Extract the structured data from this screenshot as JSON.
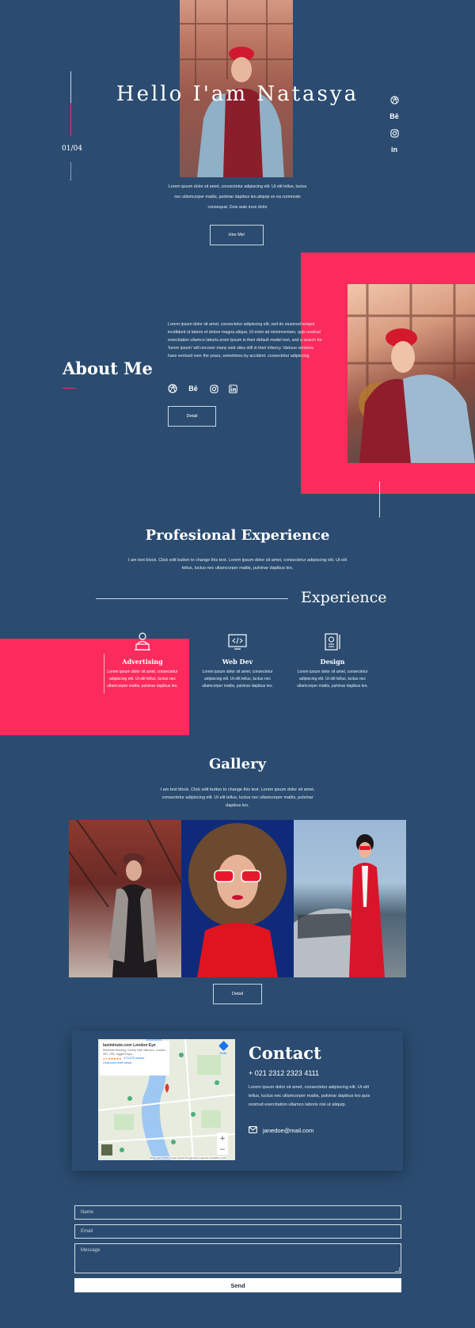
{
  "hero": {
    "title": "Hello I'am Natasya",
    "counter": "01/04",
    "text": "Lorem ipsum dolor sit amet, consectetur adipiscing elit. Ut elit tellus, luctus nec ullamcorper mattis, pulvinar dapibus leo.aliquip ex ea commodo consequat. Duis aute irure dolor",
    "button": "Hire Me!"
  },
  "social": {
    "dribbble": "dribbble-icon",
    "behance": "Bē",
    "instagram": "instagram-icon",
    "linkedin": "in"
  },
  "about": {
    "title": "About Me",
    "text": "Lorem ipsum dolor sit amet, consectetur adipiscing elit, sed do eiusmod tempor incididunt ut labore et dolore magna aliqua. Ut enim ad minimveniam, quis nostrud exercitation ullamco laboris.orem Ipsum is their default model text, and a search for 'lorem ipsum' will uncover many web sites still in their infancy. Various versions have evolved over the years, sometimes by accident. consectetur adipiscing",
    "button": "Detail"
  },
  "experience": {
    "title": "Profesional Experience",
    "text": "I am text block. Click edit button to change this text. Lorem ipsum dolor sit amet, consectetur adipiscing elit. Ut elit tellus, luctus nec ullamcorper mattis, pulvinar dapibus leo.",
    "label": "Experience",
    "items": [
      {
        "title": "Advertising",
        "text": "Lorem ipsum dolor sit amet, consectetur adipiscing elit. Ut elit tellus, luctus nec ullamcorper mattis, pulvinar dapibus leo."
      },
      {
        "title": "Web Dev",
        "text": "Lorem ipsum dolor sit amet, consectetur adipiscing elit. Ut elit tellus, luctus nec ullamcorper mattis, pulvinar dapibus leo."
      },
      {
        "title": "Design",
        "text": "Lorem ipsum dolor sit amet, consectetur adipiscing elit. Ut elit tellus, luctus nec ullamcorper mattis, pulvinar dapibus leo."
      }
    ]
  },
  "gallery": {
    "title": "Gallery",
    "text": "I am text block. Click edit button to change this text. Lorem ipsum dolor sit amet, consectetur adipiscing elit. Ut elit tellus, luctus nec ullamcorper mattis, pulvinar dapibus leo.",
    "button": "Detail"
  },
  "contact": {
    "title": "Contact",
    "phone": "+ 021 2312 2323 4111",
    "text": "Lorem ipsum dolor sit amet, consectetur adipiscing elit. Ut elit tellus, luctus nec ullamcorper mattis, pulvinar dapibus leo.quis nostrud exercitation ullamco laboris nisi ut aliquip.",
    "email": "janedoe@mail.com",
    "map": {
      "place": "lastminute.com London Eye",
      "address": "Riverside Building, County Hall, Bishop's, London SE1 7PB, Inggris Raya",
      "rating": "4,5 ★★★★★",
      "reviews": "174.575 ulasan",
      "view_larger": "Lihat peta lebih besar",
      "route": "Rute",
      "footer": "Data peta ©2023 Google   Syarat Penggunaan   Laporkan kesalahan peta"
    }
  },
  "form": {
    "name": "Name",
    "email": "Email",
    "message": "Message",
    "send": "Send"
  },
  "colors": {
    "background": "#2b4c70",
    "accent": "#fc2a5d"
  }
}
